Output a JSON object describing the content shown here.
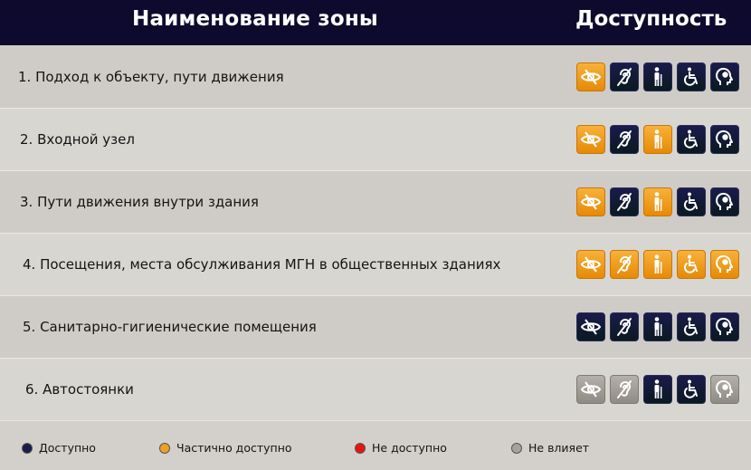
{
  "header": {
    "zone_title": "Наименование зоны",
    "access_title": "Доступность"
  },
  "status_colors": {
    "available": "#1a1b4b",
    "partial": "#f0a020",
    "unavailable": "#ee1111",
    "none": "#a6a29b"
  },
  "icon_types": [
    "vision-impaired-icon",
    "hearing-impaired-icon",
    "mobility-impaired-icon",
    "wheelchair-icon",
    "mental-impaired-icon"
  ],
  "zones": [
    {
      "label": "1. Подход к объекту, пути движения",
      "statuses": [
        "partial",
        "available",
        "available",
        "available",
        "available"
      ]
    },
    {
      "label": "2. Входной узел",
      "statuses": [
        "partial",
        "available",
        "partial",
        "available",
        "available"
      ]
    },
    {
      "label": "3. Пути движения внутри здания",
      "statuses": [
        "partial",
        "available",
        "partial",
        "available",
        "available"
      ]
    },
    {
      "label": "4. Посещения, места обсулживания МГН в общественных зданиях",
      "statuses": [
        "partial",
        "partial",
        "partial",
        "partial",
        "partial"
      ]
    },
    {
      "label": "5. Санитарно-гигиенические помещения",
      "statuses": [
        "available",
        "available",
        "available",
        "available",
        "available"
      ]
    },
    {
      "label": "6. Автостоянки",
      "statuses": [
        "none",
        "none",
        "available",
        "available",
        "none"
      ]
    }
  ],
  "legend": [
    {
      "status": "available",
      "label": "Доступно"
    },
    {
      "status": "partial",
      "label": "Частично доступно"
    },
    {
      "status": "unavailable",
      "label": "Не доступно"
    },
    {
      "status": "none",
      "label": "Не влияет"
    }
  ]
}
